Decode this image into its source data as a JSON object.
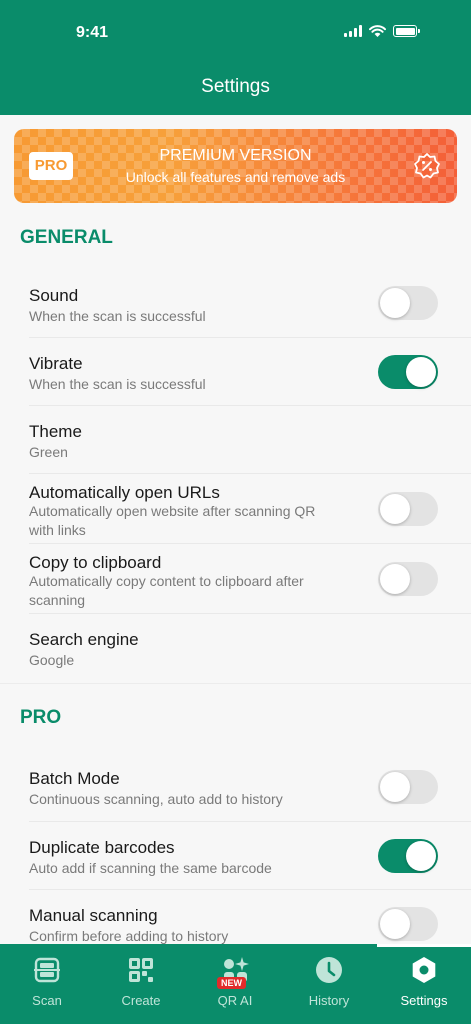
{
  "status_bar": {
    "time": "9:41"
  },
  "header": {
    "title": "Settings"
  },
  "premium": {
    "badge": "PRO",
    "title": "PREMIUM VERSION",
    "subtitle": "Unlock all features and remove ads",
    "icon": "discount-badge-icon"
  },
  "general": {
    "heading": "GENERAL",
    "items": [
      {
        "title": "Sound",
        "subtitle": "When the scan is successful",
        "toggle": false
      },
      {
        "title": "Vibrate",
        "subtitle": "When the scan is successful",
        "toggle": true
      },
      {
        "title": "Theme",
        "subtitle": "Green"
      },
      {
        "title": "Automatically open URLs",
        "subtitle": "Automatically open website after scanning QR with links",
        "toggle": false
      },
      {
        "title": "Copy to clipboard",
        "subtitle": "Automatically copy content to clipboard after scanning",
        "toggle": false
      },
      {
        "title": "Search engine",
        "subtitle": "Google"
      }
    ]
  },
  "pro": {
    "heading": "PRO",
    "items": [
      {
        "title": "Batch Mode",
        "subtitle": "Continuous scanning, auto add to history",
        "toggle": false
      },
      {
        "title": "Duplicate barcodes",
        "subtitle": "Auto add if scanning the same barcode",
        "toggle": true
      },
      {
        "title": "Manual scanning",
        "subtitle": "Confirm before adding to history",
        "toggle": false
      }
    ]
  },
  "tabbar": {
    "tabs": [
      {
        "label": "Scan",
        "icon": "scan-icon"
      },
      {
        "label": "Create",
        "icon": "qr-grid-icon"
      },
      {
        "label": "QR AI",
        "icon": "ai-sparkle-icon",
        "badge": "NEW"
      },
      {
        "label": "History",
        "icon": "clock-icon"
      },
      {
        "label": "Settings",
        "icon": "hexagon-settings-icon",
        "active": true
      }
    ]
  },
  "colors": {
    "primary": "#0a8c6a",
    "banner_start": "#f79a33",
    "banner_end": "#f45f38",
    "toggle_off": "#e3e3e3"
  }
}
